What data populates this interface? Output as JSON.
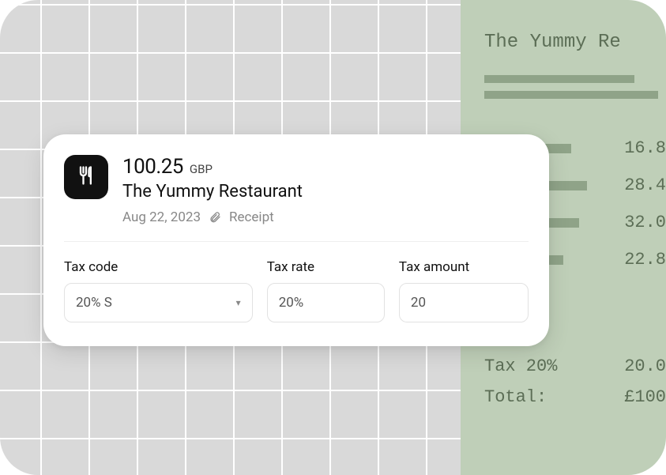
{
  "card": {
    "amount": "100.25",
    "currency": "GBP",
    "merchant": "The Yummy Restaurant",
    "date": "Aug 22, 2023",
    "attachment_label": "Receipt"
  },
  "form": {
    "tax_code_label": "Tax code",
    "tax_code_value": "20% S",
    "tax_rate_label": "Tax rate",
    "tax_rate_value": "20%",
    "tax_amount_label": "Tax amount",
    "tax_amount_value": "20"
  },
  "receipt": {
    "title": "The Yummy Re",
    "line_values": [
      "16.8",
      "28.4",
      "32.0",
      "22.8"
    ],
    "tax_label": "Tax 20%",
    "tax_value": "20.0",
    "total_label": "Total:",
    "total_value": "£100"
  }
}
